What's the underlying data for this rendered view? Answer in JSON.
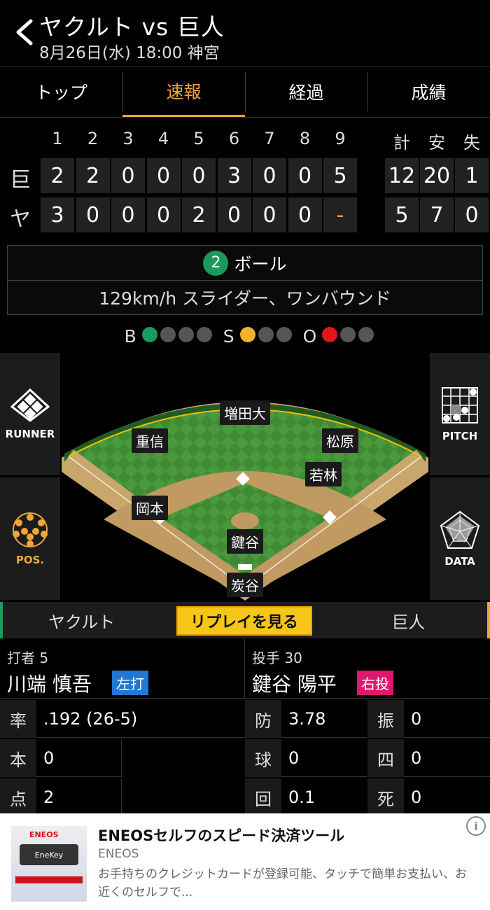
{
  "header": {
    "title": "ヤクルト vs 巨人",
    "subtitle": "8月26日(水) 18:00 神宮",
    "back_icon": "chevron-left-icon"
  },
  "tabs": [
    {
      "label": "トップ",
      "active": false
    },
    {
      "label": "速報",
      "active": true
    },
    {
      "label": "経過",
      "active": false
    },
    {
      "label": "成績",
      "active": false
    }
  ],
  "scoreboard": {
    "innings": [
      "1",
      "2",
      "3",
      "4",
      "5",
      "6",
      "7",
      "8",
      "9"
    ],
    "totals_headers": [
      "計",
      "安",
      "失"
    ],
    "teams": [
      {
        "label": "巨",
        "runs": [
          "2",
          "2",
          "0",
          "0",
          "0",
          "3",
          "0",
          "0",
          "5"
        ],
        "totals": [
          "12",
          "20",
          "1"
        ]
      },
      {
        "label": "ヤ",
        "runs": [
          "3",
          "0",
          "0",
          "0",
          "2",
          "0",
          "0",
          "0",
          "-"
        ],
        "totals": [
          "5",
          "7",
          "0"
        ]
      }
    ]
  },
  "pitch": {
    "count_number": "2",
    "result": "ボール",
    "detail": "129km/h スライダー、ワンバウンド"
  },
  "count": {
    "b_label": "B",
    "s_label": "S",
    "o_label": "O",
    "balls": 1,
    "balls_max": 4,
    "strikes": 1,
    "strikes_max": 3,
    "outs": 1,
    "outs_max": 3,
    "colors": {
      "ball": "#1a9a5e",
      "strike": "#f0b429",
      "out": "#e0161b",
      "empty": "#555555"
    }
  },
  "side_buttons": {
    "runner": "RUNNER",
    "pos": "POS.",
    "pitch": "PITCH",
    "data": "DATA"
  },
  "fielders": {
    "cf": "増田大",
    "lf": "重信",
    "rf": "松原",
    "2b": "若林",
    "3b": "岡本",
    "p": "鍵谷",
    "c": "炭谷"
  },
  "team_tabs": {
    "home": "ヤクルト",
    "replay": "リプレイを見る",
    "away": "巨人"
  },
  "batter": {
    "role": "打者 5",
    "name": "川端 慎吾",
    "hand": "左打"
  },
  "pitcher": {
    "role": "投手 30",
    "name": "鍵谷 陽平",
    "hand": "右投"
  },
  "batter_stats": [
    {
      "key": "率",
      "value": ".192 (26-5)"
    },
    {
      "key": "本",
      "value": "0"
    },
    {
      "key": "点",
      "value": "2"
    }
  ],
  "pitcher_stats": [
    {
      "key": "防",
      "value": "3.78"
    },
    {
      "key": "球",
      "value": "0"
    },
    {
      "key": "回",
      "value": "0.1"
    }
  ],
  "pitcher_stats2": [
    {
      "key": "振",
      "value": "0"
    },
    {
      "key": "四",
      "value": "0"
    },
    {
      "key": "死",
      "value": "0"
    }
  ],
  "ad": {
    "title": "ENEOSセルフのスピード決済ツール",
    "brand": "ENEOS",
    "description": "お手持ちのクレジットカードが登録可能、タッチで簡単お支払い、お近くのセルフで...",
    "logo_text": "ENEOS",
    "card_text": "EneKey"
  }
}
